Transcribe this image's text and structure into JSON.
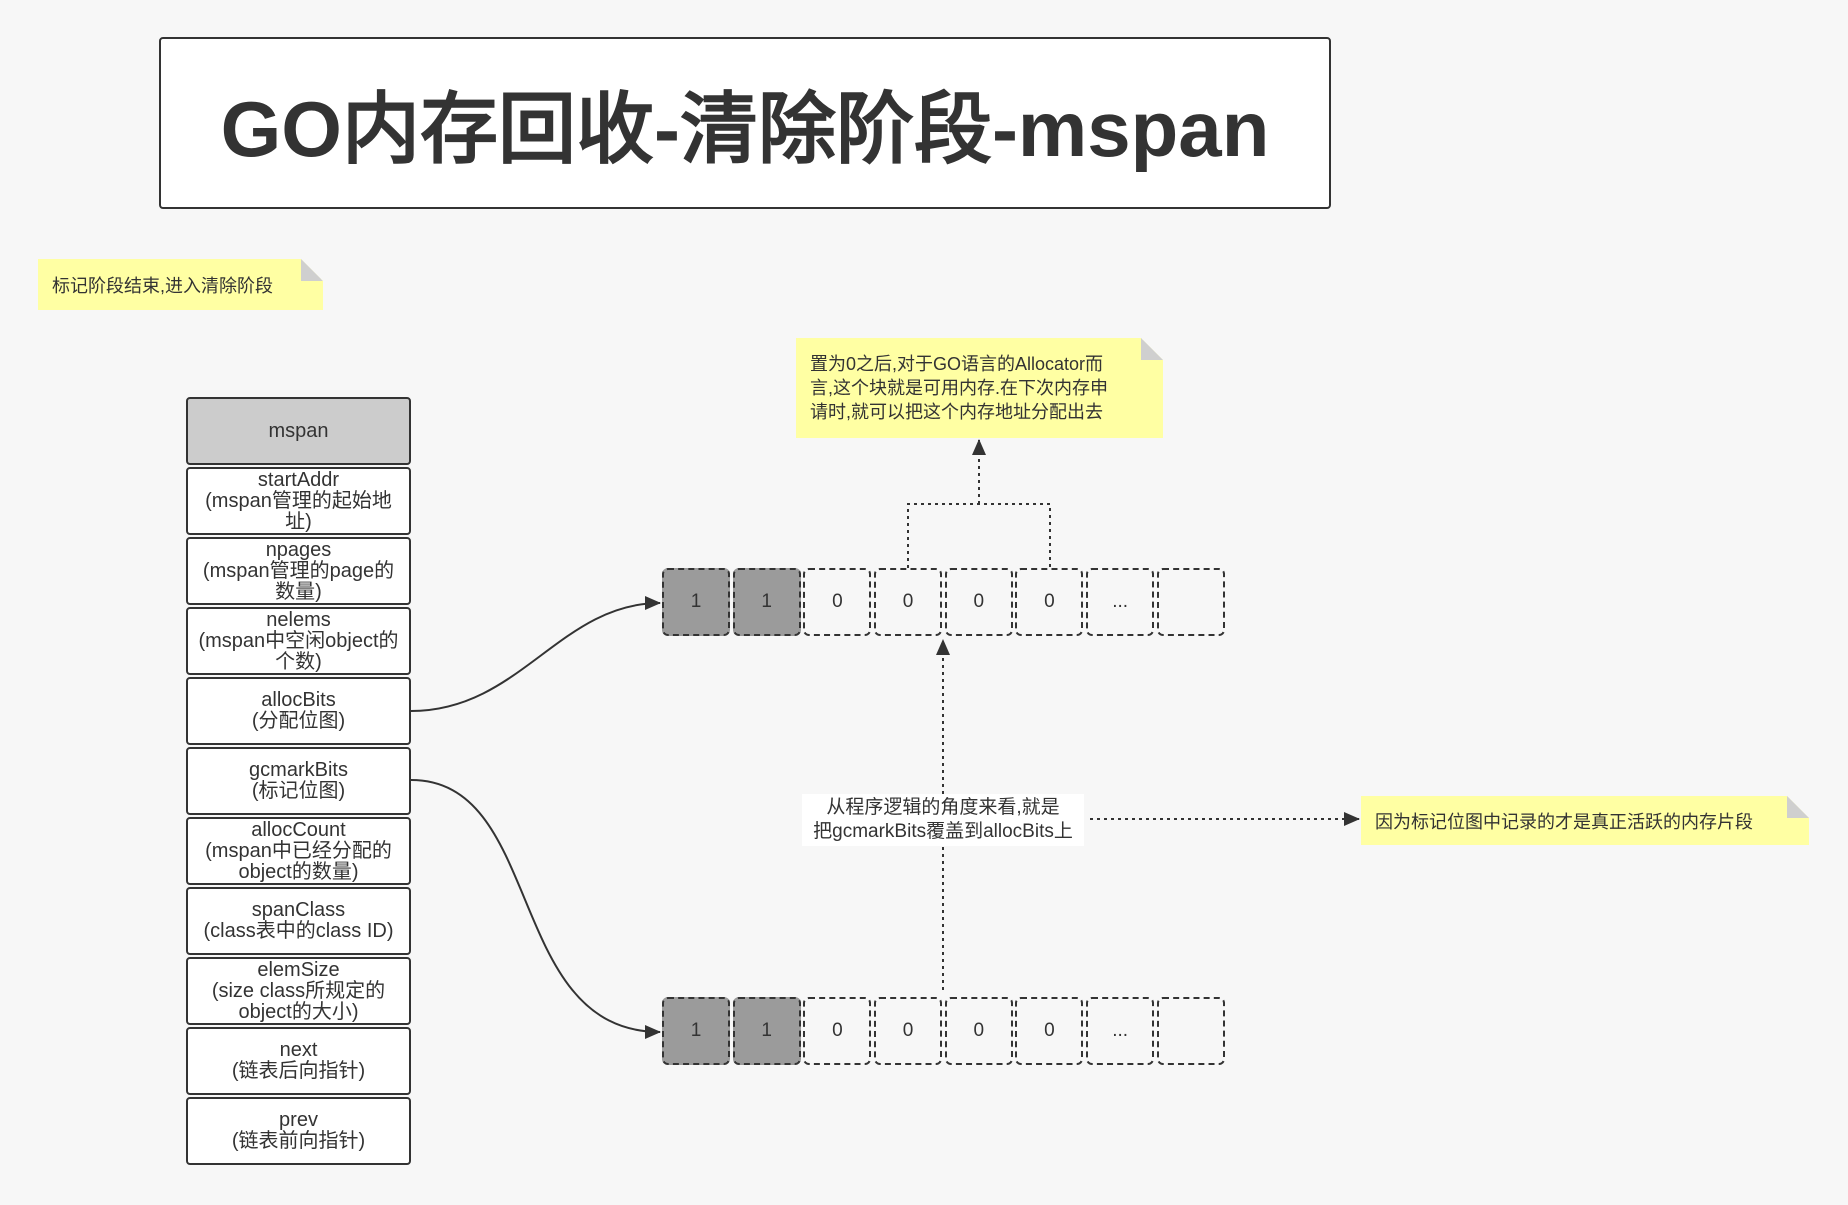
{
  "title": "GO内存回收-清除阶段-mspan",
  "notes": {
    "phase_note": "标记阶段结束,进入清除阶段",
    "allocator_note": [
      "置为0之后,对于GO语言的Allocator而",
      "言,这个块就是可用内存.在下次内存申",
      "请时,就可以把这个内存地址分配出去"
    ],
    "active_note": "因为标记位图中记录的才是真正活跃的内存片段"
  },
  "mspan": {
    "header": "mspan",
    "fields": [
      {
        "name": "startAddr",
        "desc": "(mspan管理的起始地址)"
      },
      {
        "name": "npages",
        "desc": "(mspan管理的page的数量)"
      },
      {
        "name": "nelems",
        "desc": "(mspan中空闲object的个数)"
      },
      {
        "name": "allocBits",
        "desc": "(分配位图)"
      },
      {
        "name": "gcmarkBits",
        "desc": "(标记位图)"
      },
      {
        "name": "allocCount",
        "desc": "(mspan中已经分配的object的数量)"
      },
      {
        "name": "spanClass",
        "desc": "(class表中的class ID)"
      },
      {
        "name": "elemSize",
        "desc": "(size class所规定的object的大小)"
      },
      {
        "name": "next",
        "desc": "(链表后向指针)"
      },
      {
        "name": "prev",
        "desc": "(链表前向指针)"
      }
    ]
  },
  "bitmaps": {
    "top_row": [
      {
        "label": "1",
        "filled": true
      },
      {
        "label": "1",
        "filled": true
      },
      {
        "label": "0",
        "filled": false
      },
      {
        "label": "0",
        "filled": false
      },
      {
        "label": "0",
        "filled": false
      },
      {
        "label": "0",
        "filled": false
      },
      {
        "label": "...",
        "filled": false
      },
      {
        "label": "",
        "filled": false
      }
    ],
    "bottom_row": [
      {
        "label": "1",
        "filled": true
      },
      {
        "label": "1",
        "filled": true
      },
      {
        "label": "0",
        "filled": false
      },
      {
        "label": "0",
        "filled": false
      },
      {
        "label": "0",
        "filled": false
      },
      {
        "label": "0",
        "filled": false
      },
      {
        "label": "...",
        "filled": false
      },
      {
        "label": "",
        "filled": false
      }
    ]
  },
  "overwrite_label": [
    "从程序逻辑的角度来看,就是",
    "把gcmarkBits覆盖到allocBits上"
  ],
  "colors": {
    "page_background": "#f7f7f7",
    "note_background": "#ffffa3",
    "header_fill": "#cccccc",
    "filled_cell": "#9b9b9b",
    "ink": "#333333"
  }
}
